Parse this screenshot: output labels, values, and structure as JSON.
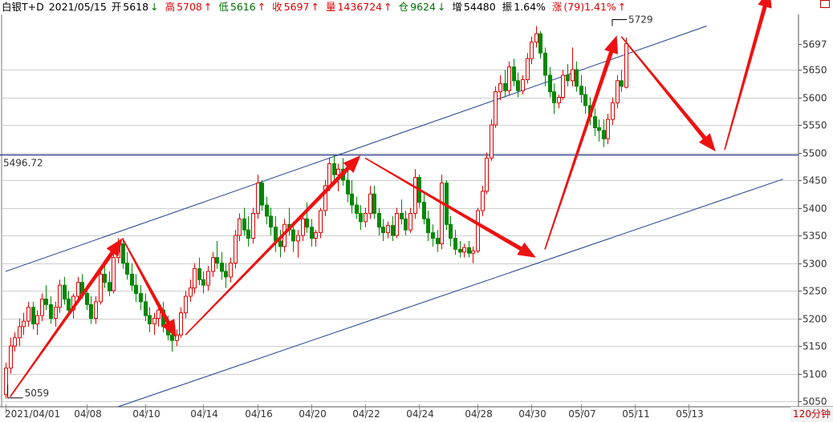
{
  "header": {
    "instrument": "白银T+D",
    "date": "2021/05/15",
    "open_label": "开",
    "open": "5618",
    "open_arrow": "↓",
    "high_label": "高",
    "high": "5708",
    "high_arrow": "↑",
    "low_label": "低",
    "low": "5616",
    "low_arrow": "↑",
    "close_label": "收",
    "close": "5697",
    "close_arrow": "↑",
    "volume_label": "量",
    "volume": "1436724",
    "volume_arrow": "↑",
    "oi_label": "仓",
    "oi": "9624",
    "oi_arrow": "↓",
    "oi_change_label": "增",
    "oi_change": "54480",
    "amplitude_label": "振",
    "amplitude": "1.64%",
    "change_label": "涨",
    "change": "(79)1.41%",
    "change_arrow": "↑"
  },
  "timeframe": "120分钟",
  "colors": {
    "up": "#e00000",
    "down": "#008800",
    "grid": "#a0a0a0",
    "trendline": "#1f3f8f",
    "arrow": "#ee1111"
  },
  "chart_data": {
    "type": "candlestick",
    "y_range": [
      5040,
      5750
    ],
    "y_ticks": [
      5050,
      5100,
      5150,
      5200,
      5250,
      5300,
      5350,
      5400,
      5450,
      5500,
      5550,
      5600,
      5650,
      5697
    ],
    "y_tick_labels": [
      "5050",
      "5100",
      "5150",
      "5200",
      "5250",
      "5300",
      "5350",
      "5400",
      "5450",
      "5500",
      "5550",
      "5600",
      "5650",
      "5697"
    ],
    "x_labels": [
      "2021/04/01",
      "04/08",
      "04/10",
      "04/14",
      "04/16",
      "04/20",
      "04/22",
      "04/24",
      "04/28",
      "04/30",
      "05/07",
      "05/11",
      "05/13"
    ],
    "x_label_bar_index": [
      0,
      18,
      31,
      44,
      56,
      68,
      80,
      92,
      105,
      117,
      128,
      140,
      152
    ],
    "reference_line": {
      "value": 5496.72,
      "label": "5496.72"
    },
    "annotations": [
      {
        "label": "5729",
        "bar_index": 135,
        "value": 5729
      },
      {
        "label": "5059",
        "bar_index": 1,
        "value": 5059
      }
    ],
    "channel_upper": [
      [
        0,
        5285
      ],
      [
        156,
        5729
      ]
    ],
    "channel_lower": [
      [
        25,
        5040
      ],
      [
        173,
        5452
      ]
    ],
    "wave_arrows": [
      [
        1,
        5058,
        26,
        5345
      ],
      [
        26,
        5345,
        38,
        5165
      ],
      [
        40,
        5170,
        79,
        5495
      ],
      [
        80,
        5490,
        118,
        5310
      ],
      [
        120,
        5325,
        136,
        5712
      ],
      [
        137,
        5710,
        158,
        5502
      ],
      [
        160,
        5505,
        170,
        5795
      ]
    ],
    "ohlc": [
      [
        5062,
        5120,
        5055,
        5110
      ],
      [
        5110,
        5165,
        5100,
        5150
      ],
      [
        5150,
        5175,
        5140,
        5165
      ],
      [
        5165,
        5200,
        5150,
        5185
      ],
      [
        5185,
        5210,
        5170,
        5195
      ],
      [
        5195,
        5230,
        5185,
        5220
      ],
      [
        5220,
        5230,
        5180,
        5190
      ],
      [
        5190,
        5215,
        5170,
        5205
      ],
      [
        5205,
        5245,
        5195,
        5235
      ],
      [
        5235,
        5260,
        5215,
        5225
      ],
      [
        5225,
        5240,
        5190,
        5200
      ],
      [
        5200,
        5230,
        5185,
        5220
      ],
      [
        5220,
        5270,
        5210,
        5260
      ],
      [
        5260,
        5275,
        5225,
        5235
      ],
      [
        5235,
        5250,
        5205,
        5215
      ],
      [
        5215,
        5245,
        5200,
        5240
      ],
      [
        5240,
        5275,
        5230,
        5265
      ],
      [
        5265,
        5280,
        5235,
        5245
      ],
      [
        5245,
        5260,
        5215,
        5225
      ],
      [
        5225,
        5240,
        5190,
        5200
      ],
      [
        5200,
        5240,
        5190,
        5230
      ],
      [
        5230,
        5290,
        5225,
        5280
      ],
      [
        5280,
        5300,
        5255,
        5265
      ],
      [
        5265,
        5285,
        5240,
        5250
      ],
      [
        5250,
        5320,
        5245,
        5310
      ],
      [
        5310,
        5345,
        5300,
        5335
      ],
      [
        5335,
        5345,
        5290,
        5300
      ],
      [
        5300,
        5320,
        5270,
        5280
      ],
      [
        5280,
        5300,
        5250,
        5260
      ],
      [
        5260,
        5280,
        5230,
        5245
      ],
      [
        5245,
        5260,
        5215,
        5230
      ],
      [
        5230,
        5245,
        5195,
        5205
      ],
      [
        5205,
        5220,
        5175,
        5190
      ],
      [
        5190,
        5210,
        5170,
        5200
      ],
      [
        5200,
        5225,
        5185,
        5215
      ],
      [
        5215,
        5230,
        5175,
        5185
      ],
      [
        5185,
        5205,
        5160,
        5170
      ],
      [
        5170,
        5190,
        5140,
        5160
      ],
      [
        5160,
        5180,
        5150,
        5170
      ],
      [
        5170,
        5220,
        5165,
        5210
      ],
      [
        5210,
        5250,
        5200,
        5240
      ],
      [
        5240,
        5270,
        5230,
        5255
      ],
      [
        5255,
        5300,
        5245,
        5290
      ],
      [
        5290,
        5310,
        5260,
        5270
      ],
      [
        5270,
        5285,
        5245,
        5260
      ],
      [
        5260,
        5295,
        5250,
        5285
      ],
      [
        5285,
        5320,
        5275,
        5310
      ],
      [
        5310,
        5340,
        5290,
        5300
      ],
      [
        5300,
        5320,
        5270,
        5285
      ],
      [
        5285,
        5300,
        5255,
        5275
      ],
      [
        5275,
        5310,
        5265,
        5300
      ],
      [
        5300,
        5360,
        5290,
        5350
      ],
      [
        5350,
        5390,
        5340,
        5380
      ],
      [
        5380,
        5400,
        5350,
        5360
      ],
      [
        5360,
        5385,
        5330,
        5345
      ],
      [
        5345,
        5400,
        5335,
        5390
      ],
      [
        5390,
        5460,
        5380,
        5445
      ],
      [
        5445,
        5450,
        5395,
        5405
      ],
      [
        5405,
        5420,
        5370,
        5385
      ],
      [
        5385,
        5400,
        5350,
        5365
      ],
      [
        5365,
        5385,
        5320,
        5340
      ],
      [
        5340,
        5360,
        5310,
        5330
      ],
      [
        5330,
        5380,
        5320,
        5370
      ],
      [
        5370,
        5400,
        5350,
        5360
      ],
      [
        5360,
        5375,
        5320,
        5340
      ],
      [
        5340,
        5360,
        5310,
        5350
      ],
      [
        5350,
        5390,
        5340,
        5380
      ],
      [
        5380,
        5410,
        5355,
        5365
      ],
      [
        5365,
        5380,
        5330,
        5345
      ],
      [
        5345,
        5360,
        5330,
        5355
      ],
      [
        5355,
        5400,
        5345,
        5395
      ],
      [
        5395,
        5450,
        5385,
        5440
      ],
      [
        5440,
        5490,
        5430,
        5480
      ],
      [
        5480,
        5495,
        5450,
        5460
      ],
      [
        5460,
        5480,
        5430,
        5470
      ],
      [
        5470,
        5490,
        5440,
        5450
      ],
      [
        5450,
        5470,
        5410,
        5425
      ],
      [
        5425,
        5450,
        5390,
        5405
      ],
      [
        5405,
        5420,
        5380,
        5390
      ],
      [
        5390,
        5405,
        5360,
        5375
      ],
      [
        5375,
        5400,
        5365,
        5390
      ],
      [
        5390,
        5440,
        5380,
        5425
      ],
      [
        5425,
        5440,
        5380,
        5390
      ],
      [
        5390,
        5400,
        5350,
        5365
      ],
      [
        5365,
        5380,
        5340,
        5355
      ],
      [
        5355,
        5375,
        5345,
        5368
      ],
      [
        5368,
        5385,
        5340,
        5350
      ],
      [
        5350,
        5400,
        5345,
        5390
      ],
      [
        5390,
        5415,
        5370,
        5380
      ],
      [
        5380,
        5395,
        5350,
        5360
      ],
      [
        5360,
        5400,
        5355,
        5390
      ],
      [
        5390,
        5470,
        5380,
        5455
      ],
      [
        5455,
        5460,
        5400,
        5410
      ],
      [
        5410,
        5425,
        5370,
        5380
      ],
      [
        5380,
        5395,
        5340,
        5355
      ],
      [
        5355,
        5370,
        5330,
        5345
      ],
      [
        5345,
        5360,
        5320,
        5335
      ],
      [
        5335,
        5460,
        5325,
        5445
      ],
      [
        5445,
        5450,
        5360,
        5370
      ],
      [
        5370,
        5385,
        5330,
        5345
      ],
      [
        5345,
        5360,
        5315,
        5325
      ],
      [
        5325,
        5340,
        5310,
        5320
      ],
      [
        5320,
        5335,
        5310,
        5328
      ],
      [
        5328,
        5340,
        5310,
        5318
      ],
      [
        5318,
        5330,
        5300,
        5322
      ],
      [
        5322,
        5400,
        5318,
        5395
      ],
      [
        5395,
        5440,
        5385,
        5430
      ],
      [
        5430,
        5500,
        5425,
        5490
      ],
      [
        5490,
        5560,
        5485,
        5550
      ],
      [
        5550,
        5620,
        5545,
        5610
      ],
      [
        5610,
        5640,
        5595,
        5625
      ],
      [
        5625,
        5650,
        5600,
        5612
      ],
      [
        5612,
        5665,
        5605,
        5655
      ],
      [
        5655,
        5670,
        5620,
        5630
      ],
      [
        5630,
        5645,
        5600,
        5612
      ],
      [
        5612,
        5640,
        5605,
        5632
      ],
      [
        5632,
        5680,
        5625,
        5670
      ],
      [
        5670,
        5710,
        5660,
        5700
      ],
      [
        5700,
        5729,
        5690,
        5715
      ],
      [
        5715,
        5720,
        5670,
        5680
      ],
      [
        5680,
        5690,
        5620,
        5640
      ],
      [
        5640,
        5655,
        5600,
        5610
      ],
      [
        5610,
        5625,
        5570,
        5590
      ],
      [
        5590,
        5605,
        5580,
        5600
      ],
      [
        5600,
        5650,
        5595,
        5640
      ],
      [
        5640,
        5660,
        5620,
        5630
      ],
      [
        5630,
        5690,
        5620,
        5650
      ],
      [
        5650,
        5665,
        5610,
        5620
      ],
      [
        5620,
        5640,
        5590,
        5605
      ],
      [
        5605,
        5620,
        5570,
        5585
      ],
      [
        5585,
        5600,
        5550,
        5565
      ],
      [
        5565,
        5580,
        5530,
        5545
      ],
      [
        5545,
        5560,
        5520,
        5540
      ],
      [
        5540,
        5560,
        5510,
        5525
      ],
      [
        5525,
        5570,
        5515,
        5560
      ],
      [
        5560,
        5600,
        5550,
        5590
      ],
      [
        5590,
        5640,
        5580,
        5630
      ],
      [
        5630,
        5650,
        5610,
        5620
      ],
      [
        5618,
        5708,
        5616,
        5697
      ]
    ]
  }
}
